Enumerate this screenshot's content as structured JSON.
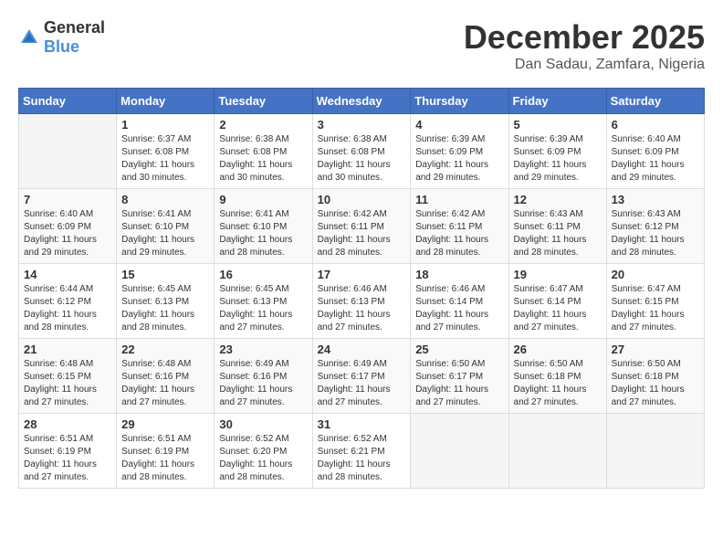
{
  "logo": {
    "general": "General",
    "blue": "Blue"
  },
  "title": "December 2025",
  "location": "Dan Sadau, Zamfara, Nigeria",
  "weekdays": [
    "Sunday",
    "Monday",
    "Tuesday",
    "Wednesday",
    "Thursday",
    "Friday",
    "Saturday"
  ],
  "weeks": [
    [
      {
        "day": "",
        "info": ""
      },
      {
        "day": "1",
        "info": "Sunrise: 6:37 AM\nSunset: 6:08 PM\nDaylight: 11 hours and 30 minutes."
      },
      {
        "day": "2",
        "info": "Sunrise: 6:38 AM\nSunset: 6:08 PM\nDaylight: 11 hours and 30 minutes."
      },
      {
        "day": "3",
        "info": "Sunrise: 6:38 AM\nSunset: 6:08 PM\nDaylight: 11 hours and 30 minutes."
      },
      {
        "day": "4",
        "info": "Sunrise: 6:39 AM\nSunset: 6:09 PM\nDaylight: 11 hours and 29 minutes."
      },
      {
        "day": "5",
        "info": "Sunrise: 6:39 AM\nSunset: 6:09 PM\nDaylight: 11 hours and 29 minutes."
      },
      {
        "day": "6",
        "info": "Sunrise: 6:40 AM\nSunset: 6:09 PM\nDaylight: 11 hours and 29 minutes."
      }
    ],
    [
      {
        "day": "7",
        "info": "Sunrise: 6:40 AM\nSunset: 6:09 PM\nDaylight: 11 hours and 29 minutes."
      },
      {
        "day": "8",
        "info": "Sunrise: 6:41 AM\nSunset: 6:10 PM\nDaylight: 11 hours and 29 minutes."
      },
      {
        "day": "9",
        "info": "Sunrise: 6:41 AM\nSunset: 6:10 PM\nDaylight: 11 hours and 28 minutes."
      },
      {
        "day": "10",
        "info": "Sunrise: 6:42 AM\nSunset: 6:11 PM\nDaylight: 11 hours and 28 minutes."
      },
      {
        "day": "11",
        "info": "Sunrise: 6:42 AM\nSunset: 6:11 PM\nDaylight: 11 hours and 28 minutes."
      },
      {
        "day": "12",
        "info": "Sunrise: 6:43 AM\nSunset: 6:11 PM\nDaylight: 11 hours and 28 minutes."
      },
      {
        "day": "13",
        "info": "Sunrise: 6:43 AM\nSunset: 6:12 PM\nDaylight: 11 hours and 28 minutes."
      }
    ],
    [
      {
        "day": "14",
        "info": "Sunrise: 6:44 AM\nSunset: 6:12 PM\nDaylight: 11 hours and 28 minutes."
      },
      {
        "day": "15",
        "info": "Sunrise: 6:45 AM\nSunset: 6:13 PM\nDaylight: 11 hours and 28 minutes."
      },
      {
        "day": "16",
        "info": "Sunrise: 6:45 AM\nSunset: 6:13 PM\nDaylight: 11 hours and 27 minutes."
      },
      {
        "day": "17",
        "info": "Sunrise: 6:46 AM\nSunset: 6:13 PM\nDaylight: 11 hours and 27 minutes."
      },
      {
        "day": "18",
        "info": "Sunrise: 6:46 AM\nSunset: 6:14 PM\nDaylight: 11 hours and 27 minutes."
      },
      {
        "day": "19",
        "info": "Sunrise: 6:47 AM\nSunset: 6:14 PM\nDaylight: 11 hours and 27 minutes."
      },
      {
        "day": "20",
        "info": "Sunrise: 6:47 AM\nSunset: 6:15 PM\nDaylight: 11 hours and 27 minutes."
      }
    ],
    [
      {
        "day": "21",
        "info": "Sunrise: 6:48 AM\nSunset: 6:15 PM\nDaylight: 11 hours and 27 minutes."
      },
      {
        "day": "22",
        "info": "Sunrise: 6:48 AM\nSunset: 6:16 PM\nDaylight: 11 hours and 27 minutes."
      },
      {
        "day": "23",
        "info": "Sunrise: 6:49 AM\nSunset: 6:16 PM\nDaylight: 11 hours and 27 minutes."
      },
      {
        "day": "24",
        "info": "Sunrise: 6:49 AM\nSunset: 6:17 PM\nDaylight: 11 hours and 27 minutes."
      },
      {
        "day": "25",
        "info": "Sunrise: 6:50 AM\nSunset: 6:17 PM\nDaylight: 11 hours and 27 minutes."
      },
      {
        "day": "26",
        "info": "Sunrise: 6:50 AM\nSunset: 6:18 PM\nDaylight: 11 hours and 27 minutes."
      },
      {
        "day": "27",
        "info": "Sunrise: 6:50 AM\nSunset: 6:18 PM\nDaylight: 11 hours and 27 minutes."
      }
    ],
    [
      {
        "day": "28",
        "info": "Sunrise: 6:51 AM\nSunset: 6:19 PM\nDaylight: 11 hours and 27 minutes."
      },
      {
        "day": "29",
        "info": "Sunrise: 6:51 AM\nSunset: 6:19 PM\nDaylight: 11 hours and 28 minutes."
      },
      {
        "day": "30",
        "info": "Sunrise: 6:52 AM\nSunset: 6:20 PM\nDaylight: 11 hours and 28 minutes."
      },
      {
        "day": "31",
        "info": "Sunrise: 6:52 AM\nSunset: 6:21 PM\nDaylight: 11 hours and 28 minutes."
      },
      {
        "day": "",
        "info": ""
      },
      {
        "day": "",
        "info": ""
      },
      {
        "day": "",
        "info": ""
      }
    ]
  ]
}
